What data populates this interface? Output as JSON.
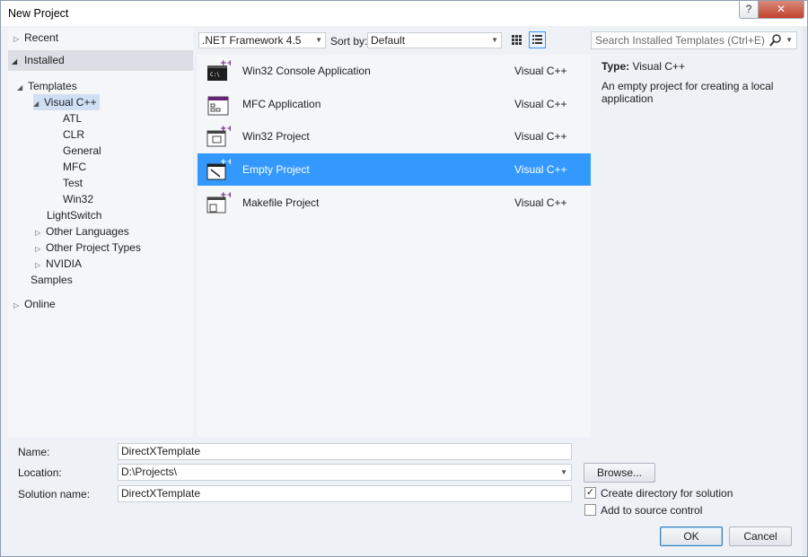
{
  "window": {
    "title": "New Project",
    "help_label": "?",
    "close_label": "✕"
  },
  "tree": {
    "recent": "Recent",
    "installed": "Installed",
    "templates": "Templates",
    "visual_cpp": "Visual C++",
    "children": [
      "ATL",
      "CLR",
      "General",
      "MFC",
      "Test",
      "Win32"
    ],
    "lightswitch": "LightSwitch",
    "other_languages": "Other Languages",
    "other_project_types": "Other Project Types",
    "nvidia": "NVIDIA",
    "samples": "Samples",
    "online": "Online"
  },
  "toolbar": {
    "framework": ".NET Framework 4.5",
    "sort_label": "Sort by:",
    "sort_value": "Default"
  },
  "search": {
    "placeholder": "Search Installed Templates (Ctrl+E)"
  },
  "templates": [
    {
      "name": "Win32 Console Application",
      "lang": "Visual C++",
      "icon": "console-app-icon"
    },
    {
      "name": "MFC Application",
      "lang": "Visual C++",
      "icon": "mfc-app-icon"
    },
    {
      "name": "Win32 Project",
      "lang": "Visual C++",
      "icon": "win32-project-icon"
    },
    {
      "name": "Empty Project",
      "lang": "Visual C++",
      "icon": "empty-project-icon"
    },
    {
      "name": "Makefile Project",
      "lang": "Visual C++",
      "icon": "makefile-project-icon"
    }
  ],
  "details": {
    "type_label": "Type:",
    "type_value": "Visual C++",
    "description": "An empty project for creating a local application"
  },
  "form": {
    "name_label": "Name:",
    "name_value": "DirectXTemplate",
    "location_label": "Location:",
    "location_value": "D:\\Projects\\",
    "solution_label": "Solution name:",
    "solution_value": "DirectXTemplate",
    "browse": "Browse...",
    "create_dir": "Create directory for solution",
    "source_control": "Add to source control",
    "ok": "OK",
    "cancel": "Cancel"
  },
  "colors": {
    "selection": "#3399ff",
    "tree_selection": "#cfe0f5",
    "vcpp_purple": "#68217a"
  }
}
